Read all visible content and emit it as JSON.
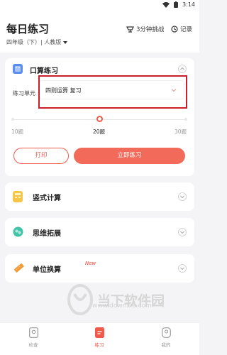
{
  "statusbar": {
    "time": "3:14"
  },
  "header": {
    "title": "每日练习",
    "grade": "四年级（下）| 人教版",
    "challenge_label": "3分钟挑战",
    "record_label": "记录"
  },
  "main_card": {
    "title": "口算练习",
    "row_label": "练习单元",
    "select_value": "四则运算 复习",
    "slider_ticks": [
      "10题",
      "20题",
      "30题"
    ],
    "selected_tick": "20题",
    "print_label": "打印",
    "start_label": "立即练习"
  },
  "sections": [
    {
      "title": "竖式计算",
      "icon": "calculator-icon"
    },
    {
      "title": "思维拓展",
      "icon": "brain-icon"
    },
    {
      "title": "单位换算",
      "icon": "ruler-icon",
      "badge": "New"
    }
  ],
  "watermark": {
    "text": "当下软件园",
    "url": "www.downxia.com"
  },
  "bottom_nav": [
    {
      "label": "检查",
      "icon": "check-icon"
    },
    {
      "label": "练习",
      "icon": "practice-icon",
      "active": true
    },
    {
      "label": "我的",
      "icon": "profile-icon"
    }
  ],
  "colors": {
    "accent": "#ef5a4b",
    "highlight_border": "#c8202a"
  }
}
